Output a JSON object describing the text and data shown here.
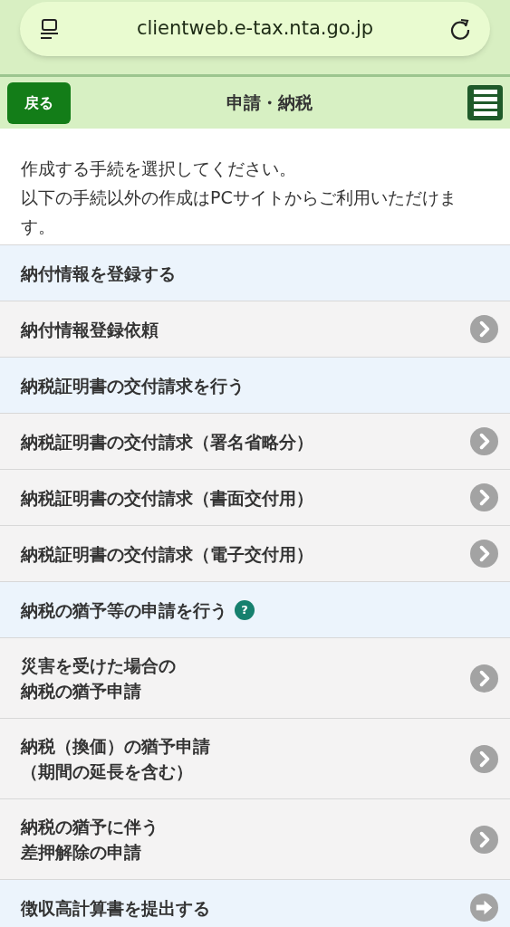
{
  "browser": {
    "url": "clientweb.e-tax.nta.go.jp"
  },
  "header": {
    "back": "戻る",
    "title": "申請・納税"
  },
  "intro": [
    "作成する手続を選択してください。",
    "以下の手続以外の作成はPCサイトからご利用いただけます。"
  ],
  "items": [
    {
      "kind": "section",
      "lines": [
        "納付情報を登録する"
      ]
    },
    {
      "kind": "link",
      "lines": [
        "納付情報登録依頼"
      ]
    },
    {
      "kind": "section",
      "lines": [
        "納税証明書の交付請求を行う"
      ]
    },
    {
      "kind": "link",
      "lines": [
        "納税証明書の交付請求（署名省略分）"
      ]
    },
    {
      "kind": "link",
      "lines": [
        "納税証明書の交付請求（書面交付用）"
      ]
    },
    {
      "kind": "link",
      "lines": [
        "納税証明書の交付請求（電子交付用）"
      ]
    },
    {
      "kind": "section",
      "lines": [
        "納税の猶予等の申請を行う"
      ],
      "help": "?"
    },
    {
      "kind": "link",
      "lines": [
        "災害を受けた場合の",
        "納税の猶予申請"
      ]
    },
    {
      "kind": "link",
      "lines": [
        "納税（換価）の猶予申請",
        "（期間の延長を含む）"
      ]
    },
    {
      "kind": "link",
      "lines": [
        "納税の猶予に伴う",
        "差押解除の申請"
      ]
    },
    {
      "kind": "action",
      "lines": [
        "徴収高計算書を提出する"
      ]
    }
  ]
}
